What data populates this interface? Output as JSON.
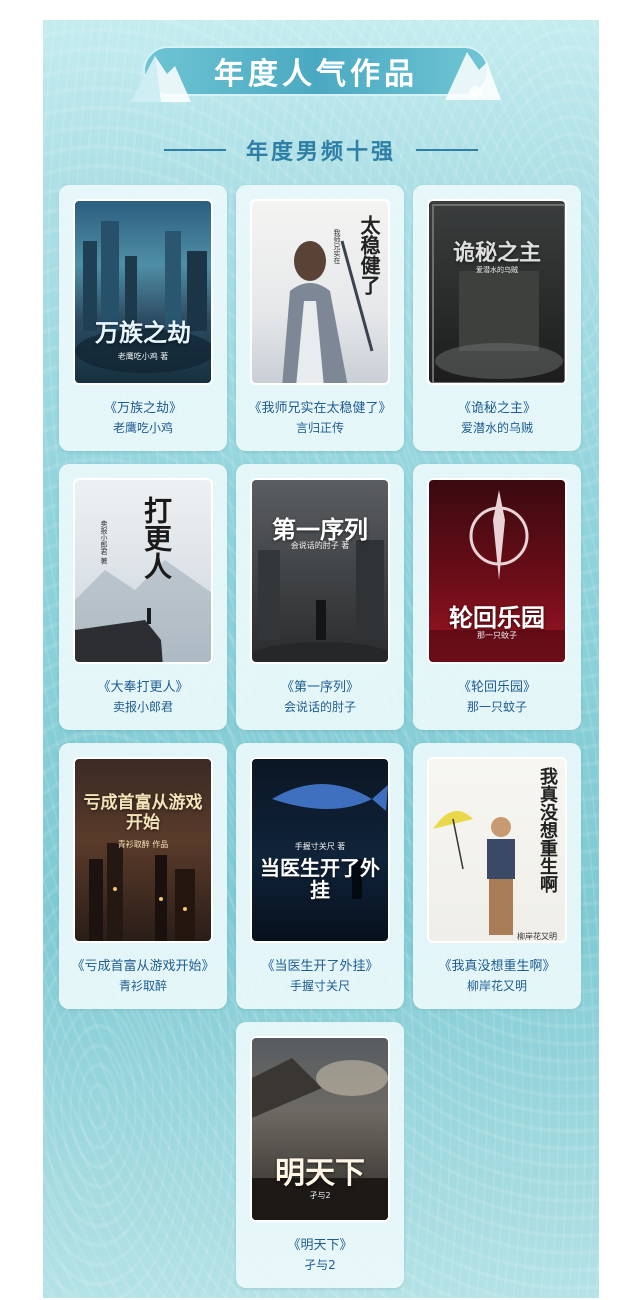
{
  "header": {
    "title": "年度人气作品",
    "subtitle": "年度男频十强"
  },
  "books": [
    {
      "title": "《万族之劫》",
      "author": "老鹰吃小鸡",
      "cover_title": "万族之劫",
      "cover_author": "老鹰吃小鸡 著"
    },
    {
      "title": "《我师兄实在太稳健了》",
      "author": "言归正传",
      "cover_title": "太稳健了",
      "cover_author": "我师兄实在"
    },
    {
      "title": "《诡秘之主》",
      "author": "爱潜水的乌贼",
      "cover_title": "诡秘之主",
      "cover_author": "爱潜水的乌贼"
    },
    {
      "title": "《大奉打更人》",
      "author": "卖报小郎君",
      "cover_title": "打更人",
      "cover_author": "卖报小郎君 著"
    },
    {
      "title": "《第一序列》",
      "author": "会说话的肘子",
      "cover_title": "第一序列",
      "cover_author": "会说话的肘子 著"
    },
    {
      "title": "《轮回乐园》",
      "author": "那一只蚊子",
      "cover_title": "轮回乐园",
      "cover_author": "那一只蚊子"
    },
    {
      "title": "《亏成首富从游戏开始》",
      "author": "青衫取醉",
      "cover_title": "亏成首富从游戏开始",
      "cover_author": "青衫取醉 作品"
    },
    {
      "title": "《当医生开了外挂》",
      "author": "手握寸关尺",
      "cover_title": "当医生开了外挂",
      "cover_author": "手握寸关尺 著"
    },
    {
      "title": "《我真没想重生啊》",
      "author": "柳岸花又明",
      "cover_title": "我真没想重生啊",
      "cover_author": "柳岸花又明"
    },
    {
      "title": "《明天下》",
      "author": "孑与2",
      "cover_title": "明天下",
      "cover_author": "孑与2"
    }
  ]
}
